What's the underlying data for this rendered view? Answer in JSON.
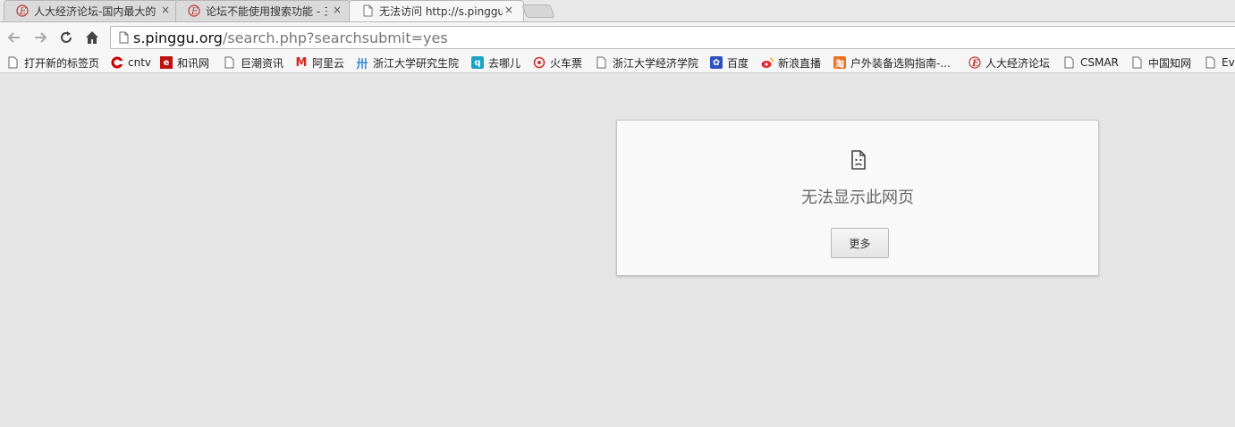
{
  "tabs": [
    {
      "title": "人大经济论坛-国内最大的",
      "close": "×",
      "icon": "pinggu-e-icon"
    },
    {
      "title": "论坛不能使用搜索功能 - 三",
      "close": "×",
      "icon": "pinggu-e-icon"
    },
    {
      "title": "无法访问 http://s.pinggu",
      "close": "×",
      "icon": "page-icon",
      "active": true
    }
  ],
  "omnibox": {
    "host": "s.pinggu.org",
    "path": "/search.php?searchsubmit=yes"
  },
  "bookmarks": [
    {
      "label": "打开新的标签页",
      "icon": "page-icon"
    },
    {
      "label": "cntv",
      "icon": "cntv-icon"
    },
    {
      "label": "和讯网",
      "icon": "hexun-icon"
    },
    {
      "label": "巨潮资讯",
      "icon": "page-icon"
    },
    {
      "label": "阿里云",
      "icon": "aliyun-icon"
    },
    {
      "label": "浙江大学研究生院",
      "icon": "zju-icon"
    },
    {
      "label": "去哪儿",
      "icon": "qunar-icon"
    },
    {
      "label": "火车票",
      "icon": "12306-icon"
    },
    {
      "label": "浙江大学经济学院",
      "icon": "page-icon"
    },
    {
      "label": "百度",
      "icon": "baidu-icon"
    },
    {
      "label": "新浪直播",
      "icon": "weibo-icon"
    },
    {
      "label": "户外装备选购指南-...",
      "icon": "taobao-icon"
    },
    {
      "label": "人大经济论坛",
      "icon": "pinggu-e-icon"
    },
    {
      "label": "CSMAR",
      "icon": "page-icon"
    },
    {
      "label": "中国知网",
      "icon": "page-icon"
    },
    {
      "label": "Eve",
      "icon": "page-icon"
    }
  ],
  "error": {
    "message": "无法显示此网页",
    "more_label": "更多"
  },
  "colors": {
    "page_bg": "#e5e5e5",
    "card_bg": "#f9f9f9",
    "url_host": "#111111",
    "url_path": "#777777"
  }
}
